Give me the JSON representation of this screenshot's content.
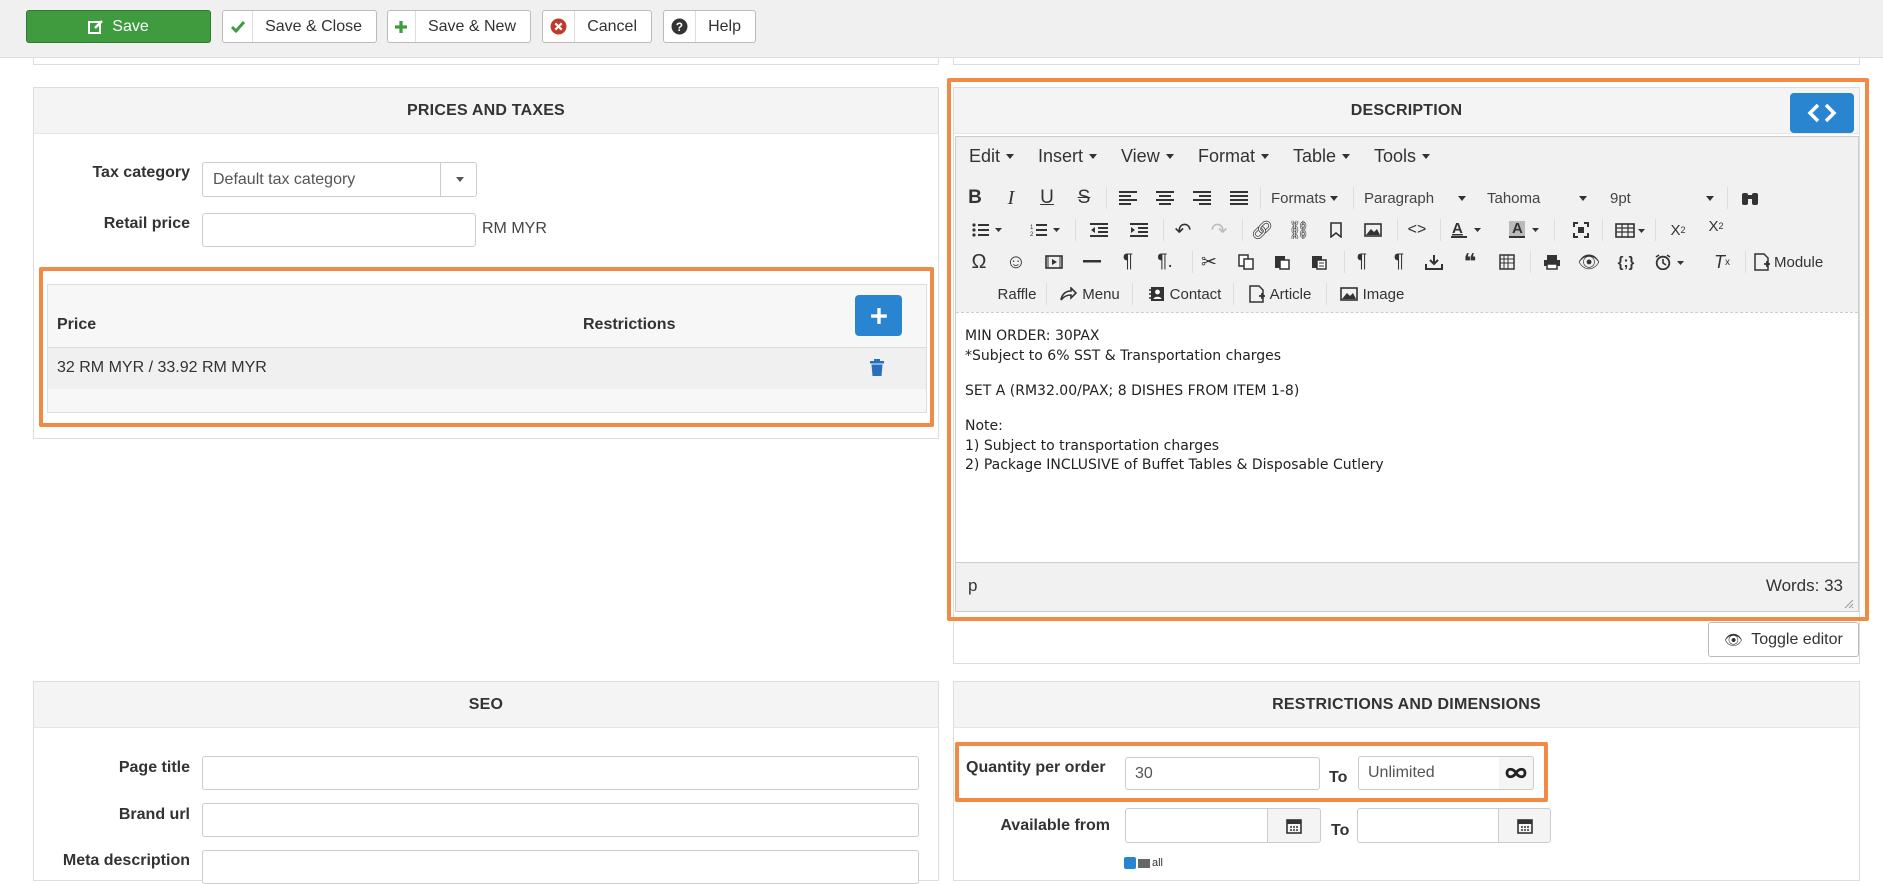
{
  "toolbar": {
    "save": "Save",
    "save_close": "Save & Close",
    "save_new": "Save & New",
    "cancel": "Cancel",
    "help": "Help"
  },
  "prices": {
    "title": "PRICES AND TAXES",
    "tax_label": "Tax category",
    "tax_value": "Default tax category",
    "retail_label": "Retail price",
    "retail_value": "",
    "currency": "RM MYR",
    "col_price": "Price",
    "col_restrictions": "Restrictions",
    "row_price": "32 RM MYR / 33.92 RM MYR",
    "row_restrictions": ""
  },
  "description": {
    "title": "DESCRIPTION",
    "menus": [
      "Edit",
      "Insert",
      "View",
      "Format",
      "Table",
      "Tools"
    ],
    "formats": "Formats",
    "block": "Paragraph",
    "font": "Tahoma",
    "size": "9pt",
    "module": "Module",
    "plugins": [
      "Raffle",
      "Menu",
      "Contact",
      "Article",
      "Image"
    ],
    "content": [
      "MIN ORDER: 30PAX",
      "*Subject to 6% SST & Transportation charges",
      "SET A (RM32.00/PAX; 8 DISHES FROM ITEM 1-8)",
      "Note:",
      "1) Subject to transportation charges",
      "2) Package INCLUSIVE of Buffet Tables & Disposable Cutlery"
    ],
    "path": "p",
    "words": "Words: 33",
    "toggle": "Toggle editor"
  },
  "seo": {
    "title": "SEO",
    "page_title_label": "Page title",
    "brand_url_label": "Brand url",
    "meta_desc_label": "Meta description"
  },
  "restrictions": {
    "title": "RESTRICTIONS AND DIMENSIONS",
    "qty_label": "Quantity per order",
    "qty_from": "30",
    "to": "To",
    "qty_to": "Unlimited",
    "avail_label": "Available from",
    "avail_to": "To",
    "all": "all"
  },
  "colors": {
    "highlight": "#f08a45",
    "save_green": "#3e9b3e",
    "accent_blue": "#2a85d1"
  }
}
